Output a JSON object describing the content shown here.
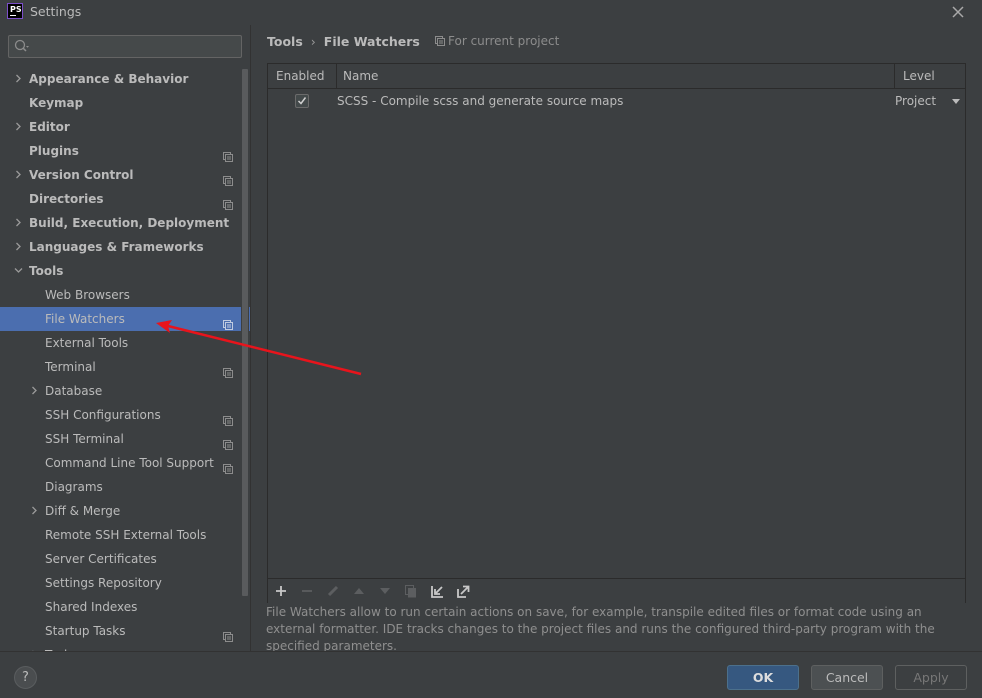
{
  "window": {
    "app_logo": "PS",
    "title": "Settings",
    "close_icon": "close-icon"
  },
  "sidebar": {
    "search": {
      "value": "",
      "placeholder": ""
    },
    "items": [
      {
        "label": "Appearance & Behavior",
        "level": 0,
        "bold": true,
        "chevron": "right",
        "project_icon": false,
        "selected": false
      },
      {
        "label": "Keymap",
        "level": 0,
        "bold": true,
        "chevron": "none",
        "project_icon": false,
        "selected": false
      },
      {
        "label": "Editor",
        "level": 0,
        "bold": true,
        "chevron": "right",
        "project_icon": false,
        "selected": false
      },
      {
        "label": "Plugins",
        "level": 0,
        "bold": true,
        "chevron": "none",
        "project_icon": true,
        "selected": false
      },
      {
        "label": "Version Control",
        "level": 0,
        "bold": true,
        "chevron": "right",
        "project_icon": true,
        "selected": false
      },
      {
        "label": "Directories",
        "level": 0,
        "bold": true,
        "chevron": "none",
        "project_icon": true,
        "selected": false
      },
      {
        "label": "Build, Execution, Deployment",
        "level": 0,
        "bold": true,
        "chevron": "right",
        "project_icon": false,
        "selected": false
      },
      {
        "label": "Languages & Frameworks",
        "level": 0,
        "bold": true,
        "chevron": "right",
        "project_icon": false,
        "selected": false
      },
      {
        "label": "Tools",
        "level": 0,
        "bold": true,
        "chevron": "down",
        "project_icon": false,
        "selected": false
      },
      {
        "label": "Web Browsers",
        "level": 1,
        "bold": false,
        "chevron": "none",
        "project_icon": false,
        "selected": false
      },
      {
        "label": "File Watchers",
        "level": 1,
        "bold": false,
        "chevron": "none",
        "project_icon": true,
        "selected": true
      },
      {
        "label": "External Tools",
        "level": 1,
        "bold": false,
        "chevron": "none",
        "project_icon": false,
        "selected": false
      },
      {
        "label": "Terminal",
        "level": 1,
        "bold": false,
        "chevron": "none",
        "project_icon": true,
        "selected": false
      },
      {
        "label": "Database",
        "level": 1,
        "bold": false,
        "chevron": "right",
        "project_icon": false,
        "selected": false
      },
      {
        "label": "SSH Configurations",
        "level": 1,
        "bold": false,
        "chevron": "none",
        "project_icon": true,
        "selected": false
      },
      {
        "label": "SSH Terminal",
        "level": 1,
        "bold": false,
        "chevron": "none",
        "project_icon": true,
        "selected": false
      },
      {
        "label": "Command Line Tool Support",
        "level": 1,
        "bold": false,
        "chevron": "none",
        "project_icon": true,
        "selected": false
      },
      {
        "label": "Diagrams",
        "level": 1,
        "bold": false,
        "chevron": "none",
        "project_icon": false,
        "selected": false
      },
      {
        "label": "Diff & Merge",
        "level": 1,
        "bold": false,
        "chevron": "right",
        "project_icon": false,
        "selected": false
      },
      {
        "label": "Remote SSH External Tools",
        "level": 1,
        "bold": false,
        "chevron": "none",
        "project_icon": false,
        "selected": false
      },
      {
        "label": "Server Certificates",
        "level": 1,
        "bold": false,
        "chevron": "none",
        "project_icon": false,
        "selected": false
      },
      {
        "label": "Settings Repository",
        "level": 1,
        "bold": false,
        "chevron": "none",
        "project_icon": false,
        "selected": false
      },
      {
        "label": "Shared Indexes",
        "level": 1,
        "bold": false,
        "chevron": "none",
        "project_icon": false,
        "selected": false
      },
      {
        "label": "Startup Tasks",
        "level": 1,
        "bold": false,
        "chevron": "none",
        "project_icon": true,
        "selected": false
      },
      {
        "label": "Tasks",
        "level": 1,
        "bold": false,
        "chevron": "right",
        "project_icon": true,
        "selected": false
      }
    ]
  },
  "main": {
    "breadcrumb": {
      "parent": "Tools",
      "separator": "›",
      "current": "File Watchers"
    },
    "scope_label": "For current project",
    "table": {
      "columns": [
        "Enabled",
        "Name",
        "Level"
      ],
      "rows": [
        {
          "enabled": true,
          "name": "SCSS - Compile scss and generate source maps",
          "level": "Project"
        }
      ]
    },
    "toolbar": [
      {
        "name": "add-button",
        "icon": "plus-icon",
        "enabled": true
      },
      {
        "name": "remove-button",
        "icon": "minus-icon",
        "enabled": false
      },
      {
        "name": "edit-button",
        "icon": "pencil-icon",
        "enabled": false
      },
      {
        "name": "move-up-button",
        "icon": "arrow-up-icon",
        "enabled": false
      },
      {
        "name": "move-down-button",
        "icon": "arrow-down-icon",
        "enabled": false
      },
      {
        "name": "copy-button",
        "icon": "copy-icon",
        "enabled": false
      },
      {
        "name": "import-button",
        "icon": "import-icon",
        "enabled": true
      },
      {
        "name": "export-button",
        "icon": "export-icon",
        "enabled": true
      }
    ],
    "description": "File Watchers allow to run certain actions on save, for example, transpile edited files or format code using an external formatter. IDE tracks changes to the project files and runs the configured third-party program with the specified parameters."
  },
  "footer": {
    "help_label": "?",
    "ok_label": "OK",
    "cancel_label": "Cancel",
    "apply_label": "Apply"
  },
  "colors": {
    "background": "#3c3f41",
    "selection": "#4b6eaf",
    "ok_button": "#365880",
    "annotation_arrow": "#e8141c"
  }
}
